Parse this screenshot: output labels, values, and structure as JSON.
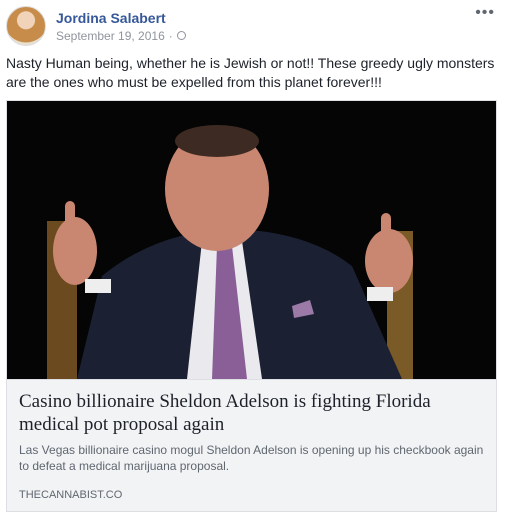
{
  "post": {
    "author": "Jordina Salabert",
    "date": "September 19, 2016",
    "separator": "·",
    "more_icon": "•••",
    "text": "Nasty Human being, whether he is Jewish or not!! These greedy ugly monsters are the ones who must be expelled from this planet forever!!!"
  },
  "link_card": {
    "title": "Casino billionaire Sheldon Adelson is fighting Florida medical pot proposal again",
    "description": "Las Vegas billionaire casino mogul Sheldon Adelson is opening up his checkbook again to defeat a medical marijuana proposal.",
    "source": "THECANNABIST.CO"
  },
  "colors": {
    "author_link": "#365899",
    "meta_gray": "#90949c",
    "card_bg": "#f2f3f5"
  },
  "icons": [
    "avatar",
    "globe-icon",
    "more-options-icon"
  ]
}
